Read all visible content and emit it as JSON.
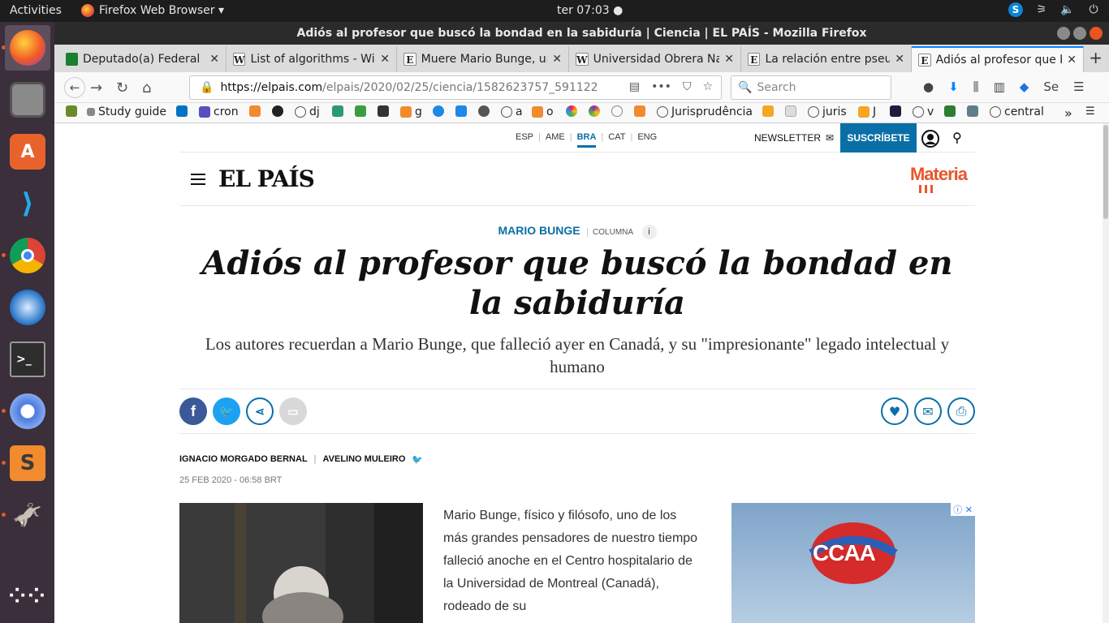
{
  "os": {
    "activities": "Activities",
    "app_menu": "Firefox Web Browser ▾",
    "clock": "ter 07:03 ●"
  },
  "window": {
    "title": "Adiós al profesor que buscó la bondad en la sabiduría | Ciencia | EL PAÍS - Mozilla Firefox"
  },
  "tabs": [
    {
      "label": "Deputado(a) Federal R",
      "icon": "camara-icon"
    },
    {
      "label": "List of algorithms - Wi",
      "icon": "wikipedia-icon"
    },
    {
      "label": "Muere Mario Bunge, un",
      "icon": "elpais-icon"
    },
    {
      "label": "Universidad Obrera Na",
      "icon": "wikipedia-icon"
    },
    {
      "label": "La relación entre pseu",
      "icon": "elpais-icon"
    },
    {
      "label": "Adiós al profesor que b",
      "icon": "elpais-icon"
    }
  ],
  "url": {
    "domain": "https://elpais.com",
    "path": "/elpais/2020/02/25/ciencia/1582623757_591122",
    "more": "•••"
  },
  "search": {
    "placeholder": "Search"
  },
  "bookmarks": [
    {
      "label": "",
      "color": "#6a8a2a"
    },
    {
      "label": "Study guide",
      "color": "#888"
    },
    {
      "label": "",
      "color": "#0072c6"
    },
    {
      "label": "cron",
      "color": "#5a4fbe"
    },
    {
      "label": "",
      "color": "#f28a2e"
    },
    {
      "label": "",
      "color": "#222"
    },
    {
      "label": "dj",
      "color": "#777"
    },
    {
      "label": "",
      "color": "#2b9a6f"
    },
    {
      "label": "",
      "color": "#3c9d3c"
    },
    {
      "label": "",
      "color": "#333"
    },
    {
      "label": "g",
      "color": "#f28a2e"
    },
    {
      "label": "",
      "color": "#1e88e5"
    },
    {
      "label": "",
      "color": "#1e88e5"
    },
    {
      "label": "",
      "color": "#555"
    },
    {
      "label": "a",
      "color": "#777"
    },
    {
      "label": "o",
      "color": "#f28a2e"
    },
    {
      "label": "",
      "color": "#e91e63"
    },
    {
      "label": "",
      "color": "#9c27b0"
    },
    {
      "label": "",
      "color": "#888"
    },
    {
      "label": "",
      "color": "#f28a2e"
    },
    {
      "label": "Jurisprudência",
      "color": "#777"
    },
    {
      "label": "",
      "color": "#f5a623"
    },
    {
      "label": "",
      "color": "#bbb"
    },
    {
      "label": "juris",
      "color": "#777"
    },
    {
      "label": "J",
      "color": "#f5a623"
    },
    {
      "label": "",
      "color": "#1c1c3c"
    },
    {
      "label": "v",
      "color": "#777"
    },
    {
      "label": "",
      "color": "#2e7d32"
    },
    {
      "label": "",
      "color": "#607d8b"
    },
    {
      "label": "central",
      "color": "#777"
    }
  ],
  "site": {
    "editions": [
      "ESP",
      "AME",
      "BRA",
      "CAT",
      "ENG"
    ],
    "active_edition": "BRA",
    "newsletter": "NEWSLETTER",
    "subscribe": "SUSCRÍBETE",
    "logo": "EL PAÍS",
    "section_logo": "Materia"
  },
  "article": {
    "kicker": "MARIO BUNGE",
    "kicker_type": "COLUMNA",
    "info": "i",
    "headline": "Adiós al profesor que buscó la bondad en la sabiduría",
    "subhead": "Los autores recuerdan a Mario Bunge, que falleció ayer en Canadá, y su \"impresionante\" legado intelectual y humano",
    "authors": [
      "IGNACIO MORGADO BERNAL",
      "AVELINO MULEIRO"
    ],
    "date": "25 FEB 2020 - 06:58 BRT",
    "body": "Mario Bunge, físico y filósofo, uno de los más grandes pensadores de nuestro tiempo falleció anoche en el Centro hospitalario de la Universidad de Montreal (Canadá), rodeado de su"
  },
  "ad": {
    "logo_text": "CCAA"
  },
  "colors": {
    "brand_blue": "#0a6fa6",
    "materia_orange": "#e8562c",
    "facebook": "#3b5998",
    "twitter": "#1da1f2"
  }
}
